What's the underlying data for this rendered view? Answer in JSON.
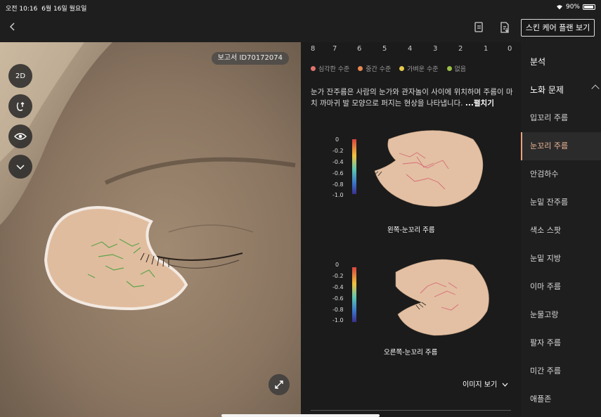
{
  "status_bar": {
    "time": "오전 10:16",
    "date": "6월 16일 월요일",
    "battery": "90%"
  },
  "nav": {
    "plan_button_label": "스킨 케어 플랜 보기"
  },
  "face_panel": {
    "report_id": "보고서 ID70172074",
    "mode_label": "2D"
  },
  "severity_scale": {
    "ticks": [
      "8",
      "7",
      "6",
      "5",
      "4",
      "3",
      "2",
      "1",
      "0"
    ]
  },
  "legend": [
    {
      "label": "심각한 수준",
      "color": "#e0736e"
    },
    {
      "label": "중간 수준",
      "color": "#e8884f"
    },
    {
      "label": "가벼운 수준",
      "color": "#e6c94a"
    },
    {
      "label": "없음",
      "color": "#9bbf4a"
    }
  ],
  "description": {
    "text": "눈가 잔주름은 사람의 눈가와 관자놀이 사이에 위치하며 주름이 마치 까마귀 발 모양으로 퍼지는 현상을 나타냅니다.",
    "more": "...펼치기"
  },
  "plots": [
    {
      "caption": "왼쪽-눈꼬리 주름",
      "colorbar_ticks": [
        "0",
        "-0.2",
        "-0.4",
        "-0.6",
        "-0.8",
        "-1.0"
      ]
    },
    {
      "caption": "오른쪽-눈꼬리 주름",
      "colorbar_ticks": [
        "0",
        "-0.2",
        "-0.4",
        "-0.6",
        "-0.8",
        "-1.0"
      ]
    }
  ],
  "view_images_label": "이미지 보기",
  "side_menu": {
    "analysis": "분석",
    "aging_header": "노화 문제",
    "items": [
      {
        "label": "입꼬리 주름",
        "active": false
      },
      {
        "label": "눈꼬리 주름",
        "active": true
      },
      {
        "label": "안검하수",
        "active": false
      },
      {
        "label": "눈밑 잔주름",
        "active": false
      },
      {
        "label": "색소 스팟",
        "active": false
      },
      {
        "label": "눈밑 지방",
        "active": false
      },
      {
        "label": "이마 주름",
        "active": false
      },
      {
        "label": "눈물고랑",
        "active": false
      },
      {
        "label": "팔자 주름",
        "active": false
      },
      {
        "label": "미간 주름",
        "active": false
      },
      {
        "label": "애플존",
        "active": false
      }
    ]
  },
  "colors": {
    "accent": "#e8a37c",
    "background": "#1c1c1e"
  }
}
